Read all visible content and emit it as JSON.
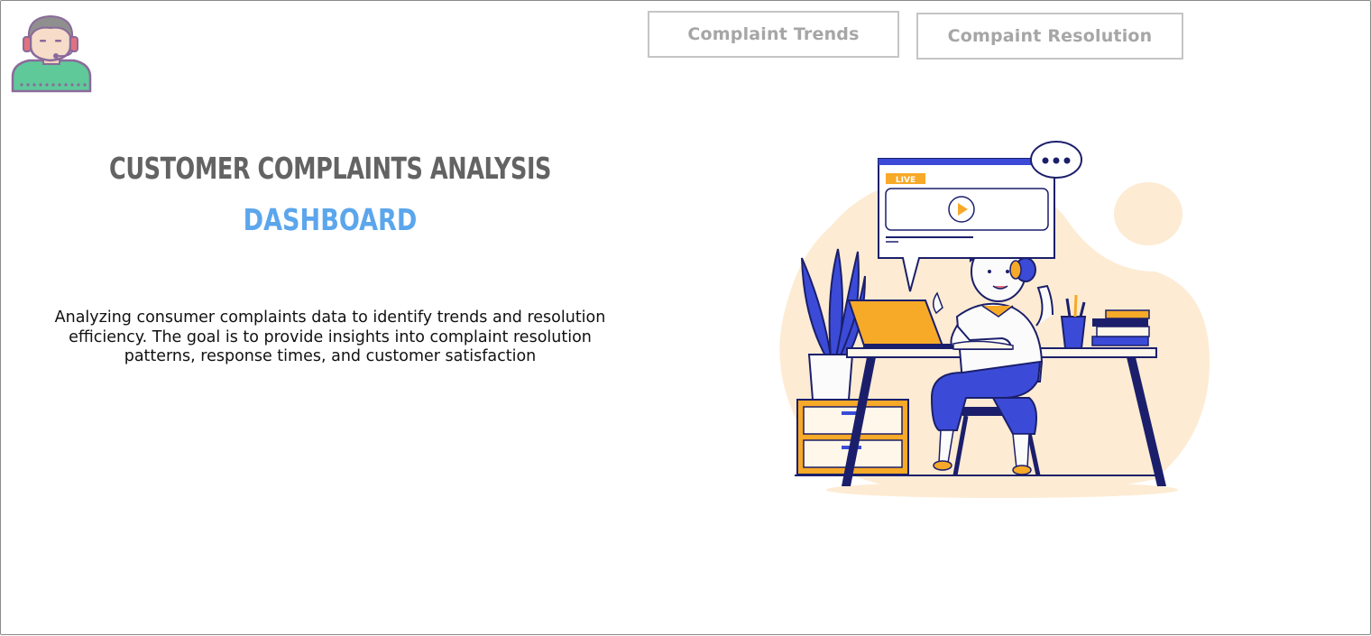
{
  "logo": {
    "icon": "support-agent-icon"
  },
  "nav": {
    "trends_label": "Complaint Trends",
    "resolution_label": "Compaint Resolution"
  },
  "hero": {
    "title": "CUSTOMER COMPLAINTS ANALYSIS",
    "subtitle": "DASHBOARD",
    "description": "Analyzing consumer complaints data to identify trends and resolution efficiency. The goal is to provide insights into complaint resolution patterns, response times, and customer satisfaction"
  },
  "illustration": {
    "icon": "person-at-desk-illustration",
    "live_badge": "LIVE"
  },
  "colors": {
    "title": "#636363",
    "subtitle": "#5ba6ec",
    "nav_text": "#a6a6a6",
    "nav_border": "#c5c5c5",
    "accent_orange": "#f7a928",
    "accent_blue": "#3b4bd8",
    "blob": "#fdebd3"
  }
}
